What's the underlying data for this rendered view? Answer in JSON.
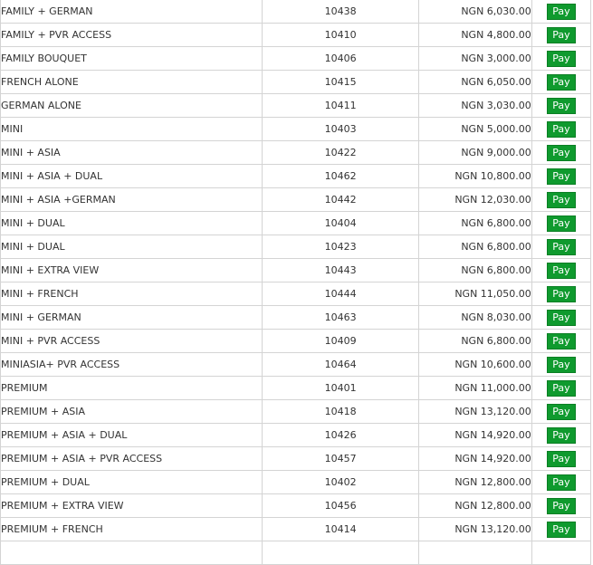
{
  "pay_label": "Pay",
  "rows": [
    {
      "name": "FAMILY + GERMAN",
      "code": "10438",
      "price": "NGN 6,030.00"
    },
    {
      "name": "FAMILY + PVR ACCESS",
      "code": "10410",
      "price": "NGN 4,800.00"
    },
    {
      "name": "FAMILY BOUQUET",
      "code": "10406",
      "price": "NGN 3,000.00"
    },
    {
      "name": "FRENCH ALONE",
      "code": "10415",
      "price": "NGN 6,050.00"
    },
    {
      "name": "GERMAN ALONE",
      "code": "10411",
      "price": "NGN 3,030.00"
    },
    {
      "name": "MINI",
      "code": "10403",
      "price": "NGN 5,000.00"
    },
    {
      "name": "MINI + ASIA",
      "code": "10422",
      "price": "NGN 9,000.00"
    },
    {
      "name": "MINI + ASIA + DUAL",
      "code": "10462",
      "price": "NGN 10,800.00"
    },
    {
      "name": "MINI + ASIA +GERMAN",
      "code": "10442",
      "price": "NGN 12,030.00"
    },
    {
      "name": "MINI + DUAL",
      "code": "10404",
      "price": "NGN 6,800.00"
    },
    {
      "name": "MINI + DUAL",
      "code": "10423",
      "price": "NGN 6,800.00"
    },
    {
      "name": "MINI + EXTRA VIEW",
      "code": "10443",
      "price": "NGN 6,800.00"
    },
    {
      "name": "MINI + FRENCH",
      "code": "10444",
      "price": "NGN 11,050.00"
    },
    {
      "name": "MINI + GERMAN",
      "code": "10463",
      "price": "NGN 8,030.00"
    },
    {
      "name": "MINI + PVR ACCESS",
      "code": "10409",
      "price": "NGN 6,800.00"
    },
    {
      "name": "MINIASIA+ PVR ACCESS",
      "code": "10464",
      "price": "NGN 10,600.00"
    },
    {
      "name": "PREMIUM",
      "code": "10401",
      "price": "NGN 11,000.00"
    },
    {
      "name": "PREMIUM + ASIA",
      "code": "10418",
      "price": "NGN 13,120.00"
    },
    {
      "name": "PREMIUM + ASIA + DUAL",
      "code": "10426",
      "price": "NGN 14,920.00"
    },
    {
      "name": "PREMIUM + ASIA + PVR ACCESS",
      "code": "10457",
      "price": "NGN 14,920.00"
    },
    {
      "name": "PREMIUM + DUAL",
      "code": "10402",
      "price": "NGN 12,800.00"
    },
    {
      "name": "PREMIUM + EXTRA VIEW",
      "code": "10456",
      "price": "NGN 12,800.00"
    },
    {
      "name": "PREMIUM + FRENCH",
      "code": "10414",
      "price": "NGN 13,120.00"
    },
    {
      "name": "",
      "code": "",
      "price": ""
    }
  ],
  "colors": {
    "pay_button_bg": "#0f9a2e",
    "pay_button_text": "#ffffff",
    "grid_line": "#d4d4d4"
  }
}
